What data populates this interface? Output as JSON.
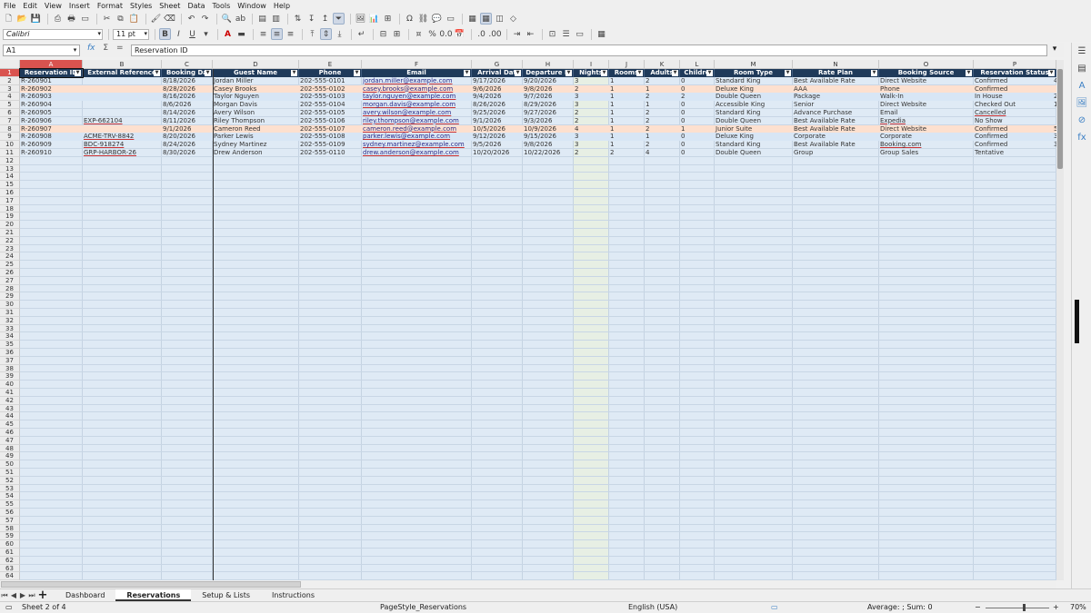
{
  "menu": [
    "File",
    "Edit",
    "View",
    "Insert",
    "Format",
    "Styles",
    "Sheet",
    "Data",
    "Tools",
    "Window",
    "Help"
  ],
  "toolbar": {
    "font_name": "Calibri",
    "font_size": "11 pt"
  },
  "formula_bar": {
    "name_box": "A1",
    "content": "Reservation ID"
  },
  "columns": [
    "A",
    "B",
    "C",
    "D",
    "E",
    "F",
    "G",
    "H",
    "I",
    "J",
    "K",
    "L",
    "M",
    "N",
    "O",
    "P"
  ],
  "table_headers": [
    "Reservation ID",
    "External Reference",
    "Booking Da",
    "Guest Name",
    "Phone",
    "Email",
    "Arrival Dat",
    "Departure D",
    "Nights",
    "Rooms",
    "Adults",
    "Childre",
    "Room Type",
    "Rate Plan",
    "Booking Source",
    "Reservation Status"
  ],
  "rows": [
    [
      "R-260901",
      "",
      "8/18/2026",
      "Jordan Miller",
      "202-555-0101",
      "jordan.miller@example.com",
      "9/17/2026",
      "9/20/2026",
      "3",
      "1",
      "2",
      "0",
      "Standard King",
      "Best Available Rate",
      "Direct Website",
      "Confirmed",
      "4"
    ],
    [
      "R-260902",
      "",
      "8/28/2026",
      "Casey Brooks",
      "202-555-0102",
      "casey.brooks@example.com",
      "9/6/2026",
      "9/8/2026",
      "2",
      "1",
      "1",
      "0",
      "Deluxe King",
      "AAA",
      "Phone",
      "Confirmed",
      ""
    ],
    [
      "R-260903",
      "",
      "8/16/2026",
      "Taylor Nguyen",
      "202-555-0103",
      "taylor.nguyen@example.com",
      "9/4/2026",
      "9/7/2026",
      "3",
      "1",
      "2",
      "2",
      "Double Queen",
      "Package",
      "Walk-In",
      "In House",
      "2"
    ],
    [
      "R-260904",
      "",
      "8/6/2026",
      "Morgan Davis",
      "202-555-0104",
      "morgan.davis@example.com",
      "8/26/2026",
      "8/29/2026",
      "3",
      "1",
      "1",
      "0",
      "Accessible King",
      "Senior",
      "Direct Website",
      "Checked Out",
      "1"
    ],
    [
      "R-260905",
      "",
      "8/14/2026",
      "Avery Wilson",
      "202-555-0105",
      "avery.wilson@example.com",
      "9/25/2026",
      "9/27/2026",
      "2",
      "1",
      "2",
      "0",
      "Standard King",
      "Advance Purchase",
      "Email",
      "Cancelled",
      ""
    ],
    [
      "R-260906",
      "EXP-662104",
      "8/11/2026",
      "Riley Thompson",
      "202-555-0106",
      "riley.thompson@example.com",
      "9/1/2026",
      "9/3/2026",
      "2",
      "1",
      "2",
      "0",
      "Double Queen",
      "Best Available Rate",
      "Expedia",
      "No Show",
      ""
    ],
    [
      "R-260907",
      "",
      "9/1/2026",
      "Cameron Reed",
      "202-555-0107",
      "cameron.reed@example.com",
      "10/5/2026",
      "10/9/2026",
      "4",
      "1",
      "2",
      "1",
      "Junior Suite",
      "Best Available Rate",
      "Direct Website",
      "Confirmed",
      "5"
    ],
    [
      "R-260908",
      "ACME-TRV-8842",
      "8/20/2026",
      "Parker Lewis",
      "202-555-0108",
      "parker.lewis@example.com",
      "9/12/2026",
      "9/15/2026",
      "3",
      "1",
      "1",
      "0",
      "Deluxe King",
      "Corporate",
      "Corporate",
      "Confirmed",
      "3"
    ],
    [
      "R-260909",
      "BDC-918274",
      "8/24/2026",
      "Sydney Martinez",
      "202-555-0109",
      "sydney.martinez@example.com",
      "9/5/2026",
      "9/8/2026",
      "3",
      "1",
      "2",
      "0",
      "Standard King",
      "Best Available Rate",
      "Booking.com",
      "Confirmed",
      "3"
    ],
    [
      "R-260910",
      "GRP-HARBOR-26",
      "8/30/2026",
      "Drew Anderson",
      "202-555-0110",
      "drew.anderson@example.com",
      "10/20/2026",
      "10/22/2026",
      "2",
      "2",
      "4",
      "0",
      "Double Queen",
      "Group",
      "Group Sales",
      "Tentative",
      ""
    ]
  ],
  "row_highlights": {
    "2": "#fde0cf",
    "7": "#fde0cf",
    "3": "#d8e6f5",
    "8": "#d8e6f5"
  },
  "sheet_tabs": [
    "Dashboard",
    "Reservations",
    "Setup & Lists",
    "Instructions"
  ],
  "active_tab": "Reservations",
  "status": {
    "sheet": "Sheet 2 of 4",
    "page_style": "PageStyle_Reservations",
    "language": "English (USA)",
    "summary": "Average: ; Sum: 0",
    "zoom": "70%"
  },
  "colors": {
    "header_bg": "#1f3a5a",
    "grid_bg": "#dfeaf5",
    "active_cell": "#d9534f"
  }
}
